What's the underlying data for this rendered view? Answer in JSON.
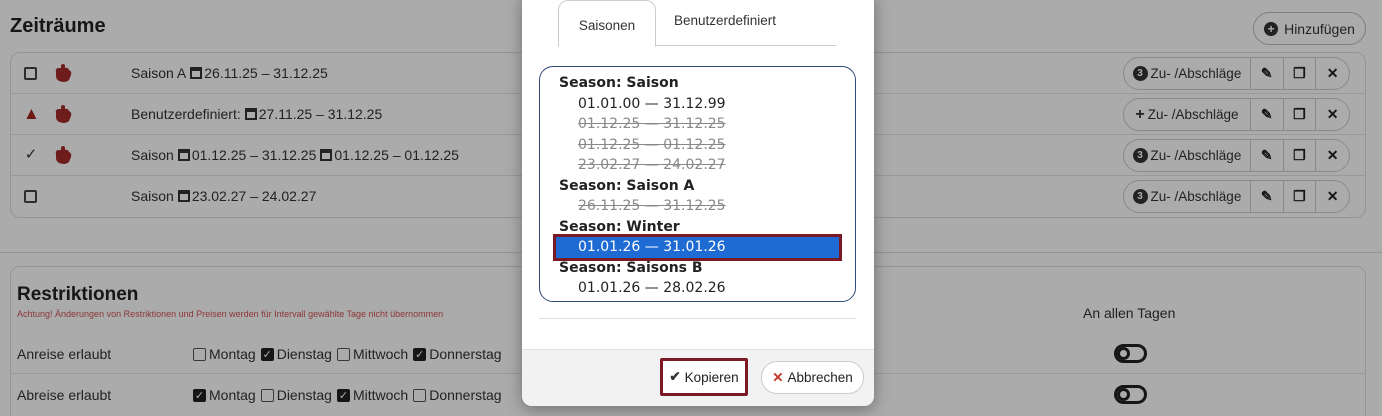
{
  "page": {
    "title": "Zeiträume",
    "add_label": "Hinzufügen",
    "periods": [
      {
        "status": "checkbox",
        "text": "Saison A",
        "dates": [
          "26.11.25 – 31.12.25"
        ],
        "zu_label": "Zu- /Abschläge",
        "zu_icon": "3"
      },
      {
        "status": "warning",
        "text": "Benutzerdefiniert:",
        "dates": [
          "27.11.25 – 31.12.25"
        ],
        "zu_label": "Zu- /Abschläge",
        "zu_icon": "+"
      },
      {
        "status": "check",
        "text": "Saison",
        "dates": [
          "01.12.25 – 31.12.25",
          "01.12.25 – 01.12.25"
        ],
        "zu_label": "Zu- /Abschläge",
        "zu_icon": "3"
      },
      {
        "status": "checkbox",
        "text": "Saison",
        "dates": [
          "23.02.27 – 24.02.27"
        ],
        "zu_label": "Zu- /Abschläge",
        "zu_icon": "3"
      }
    ],
    "restrictions": {
      "title": "Restriktionen",
      "note": "Achtung! Änderungen von Restriktionen und Preisen werden für Intervall gewählte Tage nicht übernommen",
      "all_days_label": "An allen Tagen",
      "rows": [
        {
          "label": "Anreise erlaubt",
          "days": [
            {
              "name": "Montag",
              "checked": false
            },
            {
              "name": "Dienstag",
              "checked": true
            },
            {
              "name": "Mittwoch",
              "checked": false
            },
            {
              "name": "Donnerstag",
              "checked": true
            }
          ]
        },
        {
          "label": "Abreise erlaubt",
          "days": [
            {
              "name": "Montag",
              "checked": true
            },
            {
              "name": "Dienstag",
              "checked": false
            },
            {
              "name": "Mittwoch",
              "checked": true
            },
            {
              "name": "Donnerstag",
              "checked": false
            }
          ]
        }
      ]
    }
  },
  "modal": {
    "tabs": [
      "Saisonen",
      "Benutzerdefiniert"
    ],
    "active_tab": "Saisonen",
    "groups": [
      {
        "label": "Season: Saison",
        "options": [
          {
            "text": "01.01.00 — 31.12.99",
            "disabled": false
          },
          {
            "text": "01.12.25 — 31.12.25",
            "disabled": true
          },
          {
            "text": "01.12.25 — 01.12.25",
            "disabled": true
          },
          {
            "text": "23.02.27 — 24.02.27",
            "disabled": true
          }
        ]
      },
      {
        "label": "Season: Saison A",
        "options": [
          {
            "text": "26.11.25 — 31.12.25",
            "disabled": true
          }
        ]
      },
      {
        "label": "Season: Winter",
        "options": [
          {
            "text": "01.01.26 — 31.01.26",
            "disabled": false,
            "selected": true
          }
        ]
      },
      {
        "label": "Season: Saisons B",
        "options": [
          {
            "text": "01.01.26 — 28.02.26",
            "disabled": false
          }
        ]
      }
    ],
    "copy_label": "Kopieren",
    "cancel_label": "Abbrechen"
  },
  "colors": {
    "highlight_border": "#7a1a26",
    "selected_bg": "#1f6bd4",
    "warning": "#a52222",
    "note": "#d15454"
  }
}
